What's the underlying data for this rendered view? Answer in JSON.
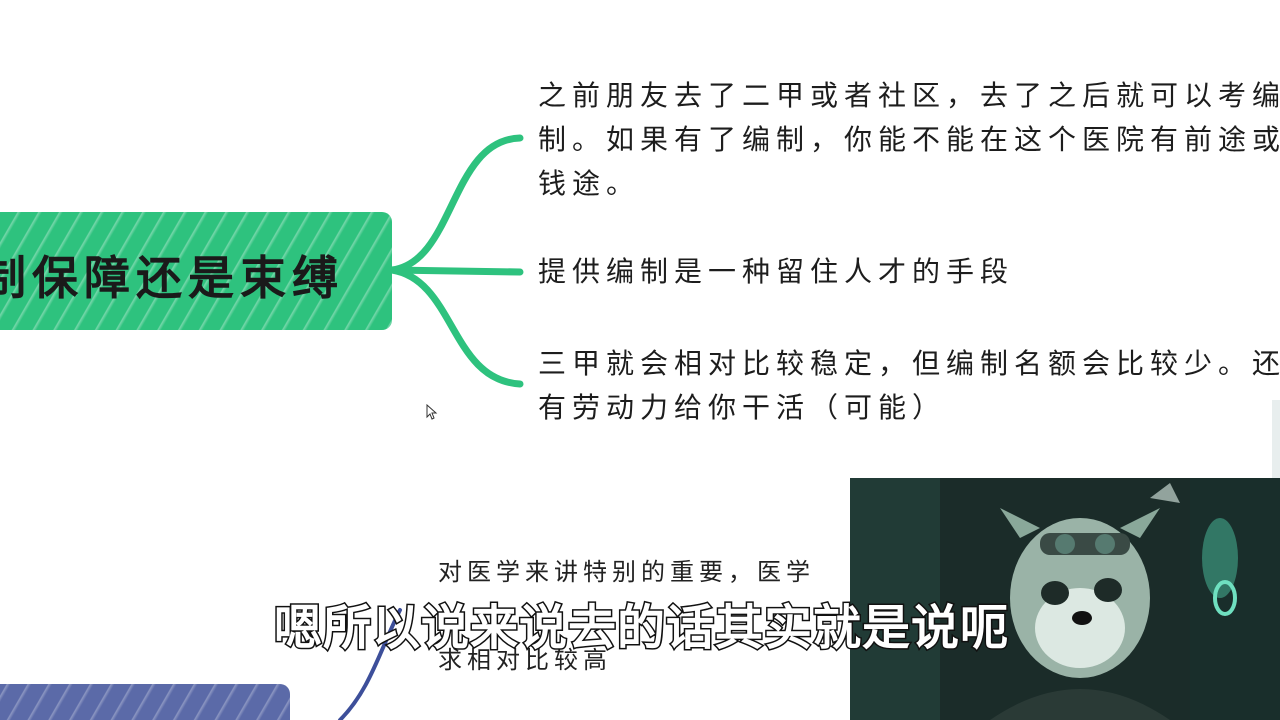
{
  "mindmap": {
    "central_label": "制保障还是束缚",
    "branches": [
      {
        "lines": [
          "之前朋友去了二甲或者社区，去了之后就可以考编",
          "制。如果有了编制，你能不能在这个医院有前途或者",
          "钱途。"
        ]
      },
      {
        "lines": [
          "提供编制是一种留住人才的手段"
        ]
      },
      {
        "lines": [
          "三甲就会相对比较稳定，但编制名额会比较少。还能",
          "有劳动力给你干活（可能）"
        ]
      }
    ],
    "lower_branch": {
      "line1": "对医学来讲特别的重要，医学",
      "line3": "求相对比较高"
    }
  },
  "video": {
    "subtitle": "嗯所以说来说去的话其实就是说呃"
  },
  "colors": {
    "green_node": "#2ec27e",
    "green_line": "#2ec27e",
    "blue_node": "#5b6aa8",
    "blue_line": "#3d4f9a"
  },
  "icons": {
    "cursor": "mouse-pointer-icon"
  }
}
